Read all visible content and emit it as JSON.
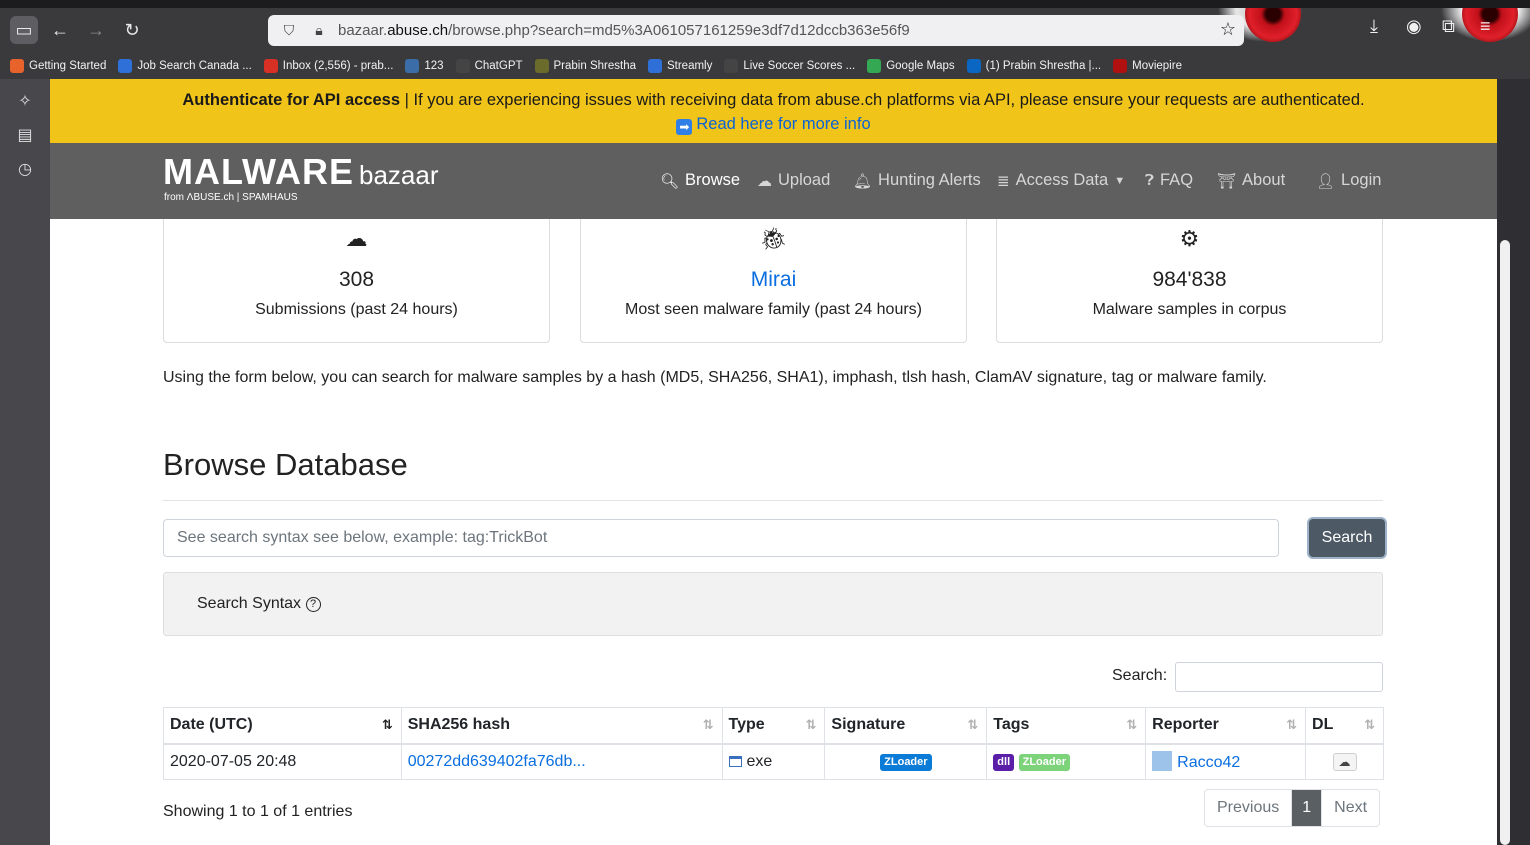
{
  "browser": {
    "url_prefix": "bazaar.",
    "url_domain": "abuse.ch",
    "url_path": "/browse.php?search=md5%3A061057161259e3df7d12dccb363e56f9",
    "bookmarks": [
      {
        "label": "Getting Started",
        "color": "#e8622c"
      },
      {
        "label": "Job Search Canada ...",
        "color": "#2f6fd8"
      },
      {
        "label": "Inbox (2,556) - prab...",
        "color": "#d93025"
      },
      {
        "label": "123",
        "color": "#3b6ea8"
      },
      {
        "label": "ChatGPT",
        "color": "#444"
      },
      {
        "label": "Prabin Shrestha",
        "color": "#6b6b2b"
      },
      {
        "label": "Streamly",
        "color": "#2f6fd8"
      },
      {
        "label": "Live Soccer Scores ...",
        "color": "#444"
      },
      {
        "label": "Google Maps",
        "color": "#34a853"
      },
      {
        "label": "(1) Prabin Shrestha |...",
        "color": "#0a66c2"
      },
      {
        "label": "Moviepire",
        "color": "#b01010"
      }
    ]
  },
  "banner": {
    "bold": "Authenticate for API access",
    "text": " | If you are experiencing issues with receiving data from abuse.ch platforms via API, please ensure your requests are authenticated.",
    "link": "Read here for more info"
  },
  "navbar": {
    "logo_main": "MALWARE",
    "logo_sub": "bazaar",
    "logo_from": "from ΛBUSE.ch | SPAMHAUS",
    "items": [
      {
        "label": "Browse",
        "icon": "search-icon"
      },
      {
        "label": "Upload",
        "icon": "cloud-upload-icon"
      },
      {
        "label": "Hunting Alerts",
        "icon": "bell-icon"
      },
      {
        "label": "Access Data",
        "icon": "database-icon"
      },
      {
        "label": "FAQ",
        "icon": "question-icon"
      },
      {
        "label": "About",
        "icon": "about-icon"
      },
      {
        "label": "Login",
        "icon": "user-icon"
      }
    ]
  },
  "stats": [
    {
      "value": "308",
      "label": "Submissions (past 24 hours)",
      "icon": "cloud-upload-icon"
    },
    {
      "value": "Mirai",
      "label": "Most seen malware family (past 24 hours)",
      "icon": "bug-icon"
    },
    {
      "value": "984'838",
      "label": "Malware samples in corpus",
      "icon": "gears-icon"
    }
  ],
  "intro": "Using the form below, you can search for malware samples by a hash (MD5, SHA256, SHA1), imphash, tlsh hash, ClamAV signature, tag or malware family.",
  "heading": "Browse Database",
  "search": {
    "placeholder": "See search syntax see below, example: tag:TrickBot",
    "button": "Search"
  },
  "syntax_label": "Search Syntax",
  "table": {
    "search_label": "Search:",
    "columns": [
      "Date (UTC)",
      "SHA256 hash",
      "Type",
      "Signature",
      "Tags",
      "Reporter",
      "DL"
    ],
    "rows": [
      {
        "date": "2020-07-05 20:48",
        "hash": "00272dd639402fa76db...",
        "type": "exe",
        "signature": "ZLoader",
        "tags": [
          "dll",
          "ZLoader"
        ],
        "reporter": "Racco42"
      }
    ],
    "info": "Showing 1 to 1 of 1 entries",
    "pager": {
      "prev": "Previous",
      "page": "1",
      "next": "Next"
    }
  }
}
